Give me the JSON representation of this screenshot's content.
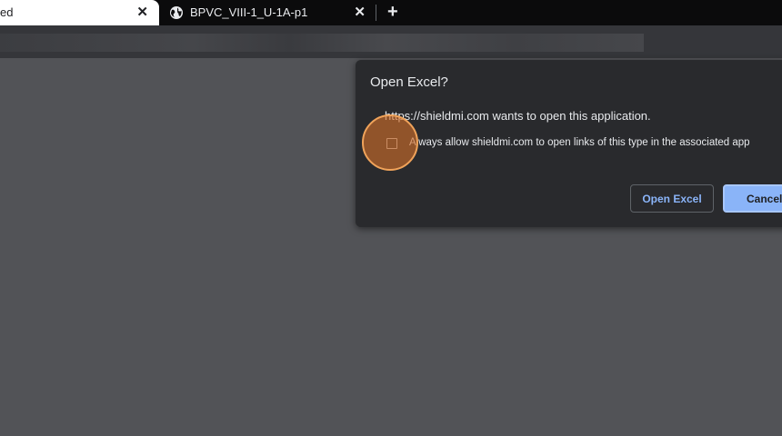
{
  "browser": {
    "tabs": [
      {
        "title": "ed",
        "close": "✕",
        "active": true
      },
      {
        "title": "BPVC_VIII-1_U-1A-p1",
        "close": "✕",
        "active": false
      }
    ],
    "new_tab": "+"
  },
  "dialog": {
    "title": "Open Excel?",
    "message": "https://shieldmi.com wants to open this application.",
    "checkbox_label": "Always allow shieldmi.com to open links of this type in the associated app",
    "checkbox_checked": false,
    "open_button": "Open Excel",
    "cancel_button": "Cancel"
  },
  "colors": {
    "accent": "#8ab4f8",
    "dialog_bg": "#292a2d",
    "page_bg": "#525357",
    "click_marker": "#e07b39"
  },
  "icons": {
    "tab_favicon": "globe-icon",
    "tab_close": "close-icon",
    "new_tab": "plus-icon"
  }
}
